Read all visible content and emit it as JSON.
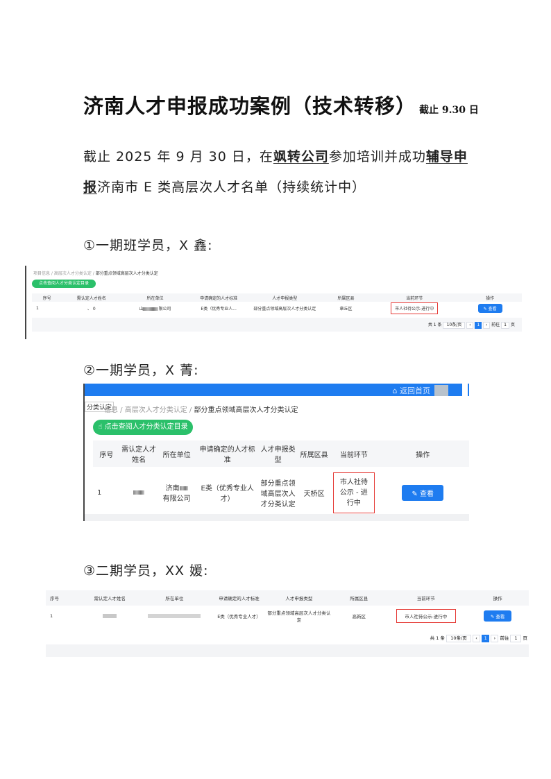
{
  "doc": {
    "title": "济南人才申报成功案例（技术转移）",
    "title_suffix": "截止 9.30 日",
    "intro_part1": "截止 2025 年 9 月 30 日，在",
    "intro_company": "飒转公司",
    "intro_part2": "参加培训并成功",
    "intro_highlight": "辅导申报",
    "intro_part3": "济南市 E 类高层次人才名单（持续统计中）"
  },
  "cases": [
    {
      "heading": "①一期班学员，X 鑫:",
      "breadcrumb": [
        "项目信息",
        "高层次人才分类认定",
        "部分重点领域高层次人才分类认定"
      ],
      "green_button": "点击查阅人才分类认定目录",
      "headers": [
        "序号",
        "需认定人才姓名",
        "所在单位",
        "申请确定的人才标准",
        "人才申报类型",
        "所属区县",
        "当前环节",
        "操作"
      ],
      "row": {
        "index": "1",
        "name": "、 0",
        "unit_prefix": "山",
        "unit_suffix": "限公司",
        "standard": "E类（优秀专业人...",
        "type": "部分重点领域高层次人才分类认定",
        "district": "章丘区",
        "stage": "市人社待公示-进行中",
        "action": "查看"
      },
      "pager": {
        "total": "共 1 条",
        "size": "10条/页",
        "page": "1",
        "goto": "前往",
        "goto_value": "1",
        "unit": "页"
      }
    },
    {
      "heading": "②一期学员，X 菁:",
      "top_right": "返回首页",
      "left_tag": "分类认定",
      "breadcrumb": [
        "信息",
        "高层次人才分类认定",
        "部分重点领域高层次人才分类认定"
      ],
      "green_button": "点击查阅人才分类认定目录",
      "headers": [
        "序号",
        "需认定人才姓名",
        "所在单位",
        "申请确定的人才标准",
        "人才申报类型",
        "所属区县",
        "当前环节",
        "操作"
      ],
      "row": {
        "index": "1",
        "unit_prefix": "济南",
        "unit_suffix": "有限公司",
        "standard": "E类（优秀专业人才）",
        "type": "部分重点领域高层次人才分类认定",
        "district": "天桥区",
        "stage": "市人社待公示 - 进行中",
        "action": "查看"
      }
    },
    {
      "heading": "③二期学员，XX 媛:",
      "headers": [
        "序号",
        "需认定人才姓名",
        "所在单位",
        "申请确定的人才标准",
        "人才申报类型",
        "所属区县",
        "当前环节",
        "操作"
      ],
      "row": {
        "index": "1",
        "standard": "E类（优秀专业人才）",
        "type": "部分重点领域高层次人才分类认定",
        "district": "高新区",
        "stage": "市人社待公示-进行中",
        "action": "查看"
      },
      "pager": {
        "total": "共 1 条",
        "size": "10条/页",
        "page": "1",
        "goto": "前往",
        "goto_value": "1",
        "unit": "页"
      }
    }
  ],
  "colors": {
    "accent": "#1e7cf0",
    "green": "#2bc06a",
    "red_box": "#e53935",
    "header_bar": "#1e7cf0"
  }
}
